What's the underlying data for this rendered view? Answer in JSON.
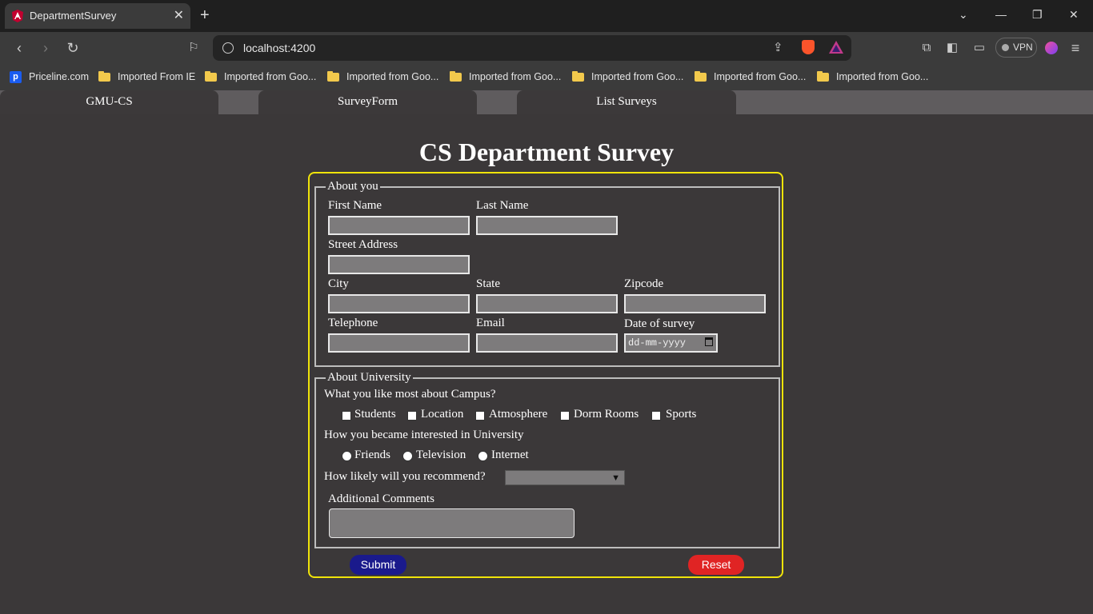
{
  "browser": {
    "tab_title": "DepartmentSurvey",
    "url": "localhost:4200",
    "vpn_label": "VPN",
    "bookmarks": [
      "Priceline.com",
      "Imported From IE",
      "Imported from Goo...",
      "Imported from Goo...",
      "Imported from Goo...",
      "Imported from Goo...",
      "Imported from Goo...",
      "Imported from Goo..."
    ]
  },
  "app_nav": {
    "items": [
      "GMU-CS",
      "SurveyForm",
      "List Surveys"
    ]
  },
  "page": {
    "title": "CS Department Survey"
  },
  "about_you": {
    "legend": "About you",
    "first_name_label": "First Name",
    "last_name_label": "Last Name",
    "street_label": "Street Address",
    "city_label": "City",
    "state_label": "State",
    "zip_label": "Zipcode",
    "telephone_label": "Telephone",
    "email_label": "Email",
    "date_label": "Date of survey",
    "date_placeholder": "dd-mm-yyyy"
  },
  "about_university": {
    "legend": "About University",
    "campus_question": "What you like most about Campus?",
    "campus_options": [
      "Students",
      "Location",
      "Atmosphere",
      "Dorm Rooms",
      "Sports"
    ],
    "interest_question": "How you became interested in University",
    "interest_options": [
      "Friends",
      "Television",
      "Internet"
    ],
    "recommend_question": "How likely will you recommend?",
    "recommend_value": "",
    "comments_label": "Additional Comments"
  },
  "buttons": {
    "submit": "Submit",
    "reset": "Reset"
  },
  "colors": {
    "submit_bg": "#1a1a8c",
    "reset_bg": "#e02424",
    "form_border": "#f0e40a",
    "page_bg": "#3b3839"
  },
  "icons": [
    "angular-logo-icon",
    "close-icon",
    "plus-icon",
    "back-icon",
    "forward-icon",
    "reload-icon",
    "bookmark-icon",
    "info-icon",
    "share-icon",
    "brave-icon",
    "rewards-icon",
    "extensions-icon",
    "sidebar-icon",
    "wallet-icon",
    "menu-icon",
    "calendar-icon",
    "chevron-down-icon"
  ]
}
